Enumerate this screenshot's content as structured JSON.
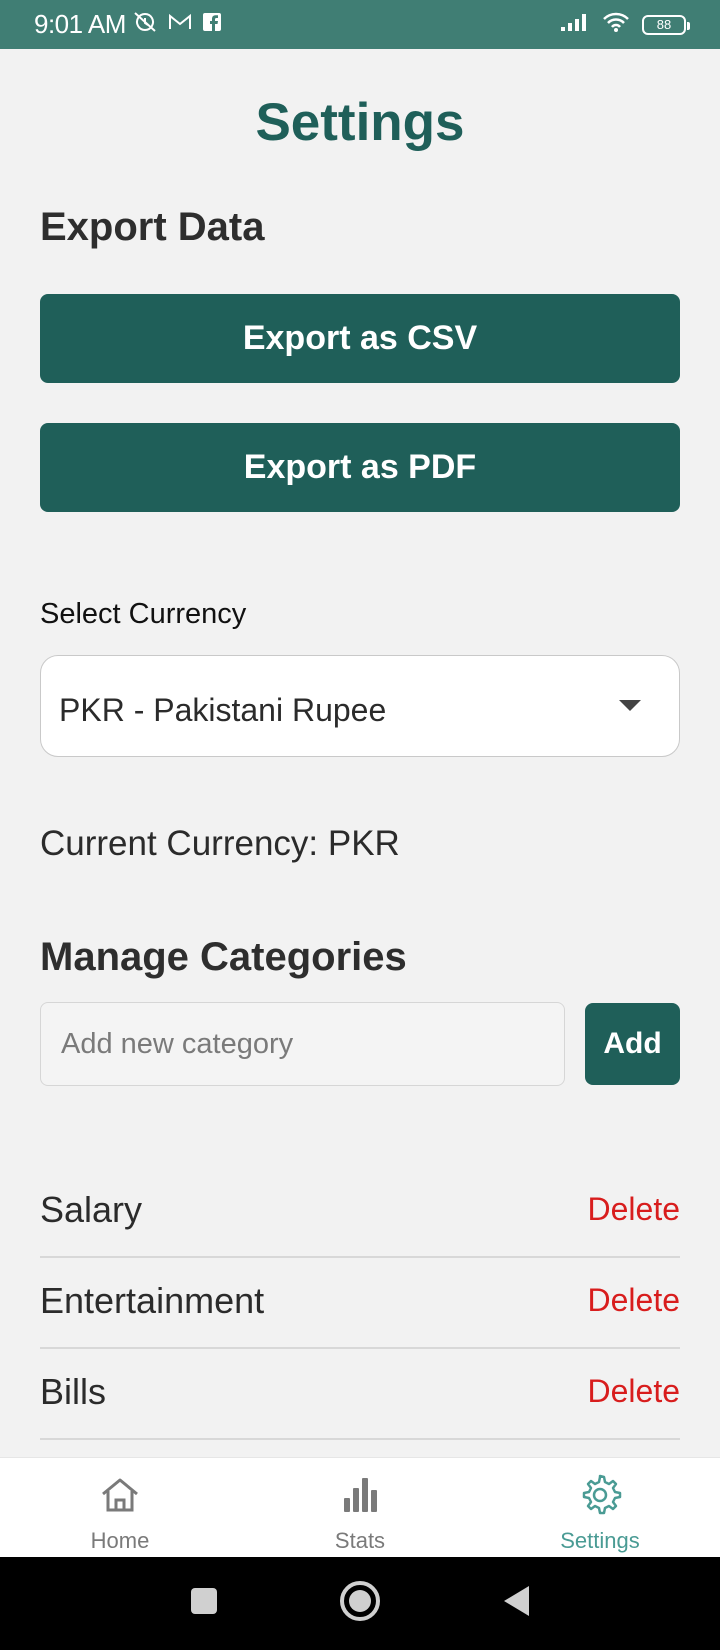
{
  "status_bar": {
    "time": "9:01 AM",
    "battery": "88",
    "left_icons": [
      "alarm-off-icon",
      "gmail-icon",
      "facebook-icon"
    ],
    "right_icons": [
      "signal-icon",
      "wifi-icon",
      "battery-icon"
    ],
    "background_color": "#407e74"
  },
  "header": {
    "title": "Settings"
  },
  "export": {
    "section_title": "Export Data",
    "csv_label": "Export as CSV",
    "pdf_label": "Export as PDF"
  },
  "currency": {
    "label": "Select Currency",
    "selected": "PKR - Pakistani Rupee",
    "current_text": "Current Currency: PKR"
  },
  "categories": {
    "section_title": "Manage Categories",
    "input_placeholder": "Add new category",
    "input_value": "",
    "add_label": "Add",
    "delete_label": "Delete",
    "items": [
      {
        "name": "Salary"
      },
      {
        "name": "Entertainment"
      },
      {
        "name": "Bills"
      }
    ]
  },
  "bottom_nav": {
    "items": [
      {
        "label": "Home",
        "icon": "home-icon",
        "active": false
      },
      {
        "label": "Stats",
        "icon": "bar-chart-icon",
        "active": false
      },
      {
        "label": "Settings",
        "icon": "gear-icon",
        "active": true
      }
    ]
  },
  "colors": {
    "primary": "#1f5f59",
    "accent_active": "#4a9b94",
    "delete": "#d81d1d",
    "background": "#f2f2f2"
  }
}
